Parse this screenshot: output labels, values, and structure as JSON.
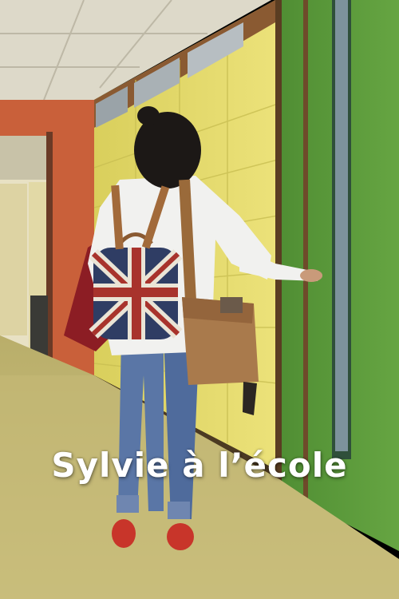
{
  "poster": {
    "title": "Sylvie à l’école"
  },
  "colors": {
    "wall_yellow": "#e2d866",
    "wall_orange": "#c9603a",
    "door_green": "#5d9a3c",
    "floor": "#c7bd78",
    "ceiling": "#dcd8c8",
    "shoes": "#c8352a",
    "jeans": "#5a76a6"
  }
}
